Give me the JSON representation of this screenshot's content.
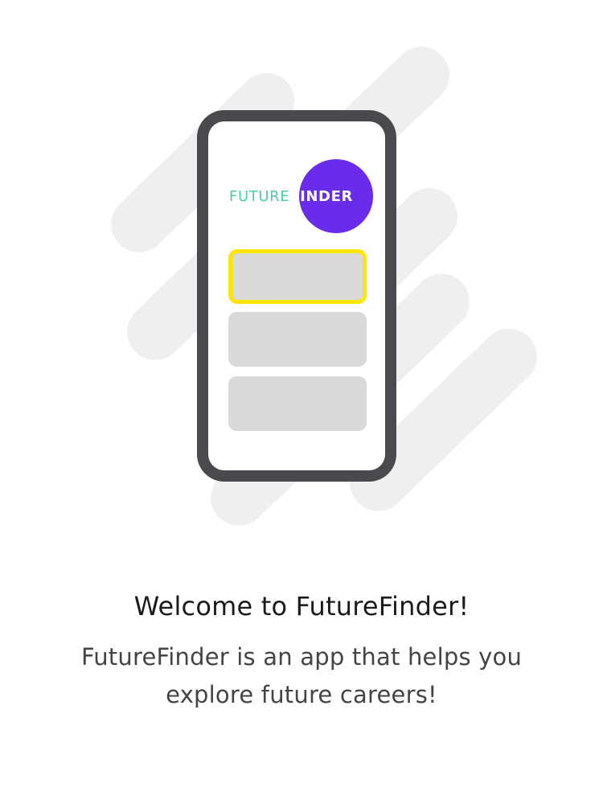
{
  "illustration": {
    "logo": {
      "text_part_1": "FUTURE",
      "text_part_2": "FINDER",
      "color_part_1": "#4ecba8",
      "color_part_2": "#ffffff",
      "circle_color": "#6a2ceb"
    },
    "highlight_color": "#ffe600",
    "card_color": "#d9d9d9",
    "phone_frame_color": "#4a4a4e",
    "stripe_color": "#efefef"
  },
  "welcome": {
    "title": "Welcome to FutureFinder!",
    "subtitle": "FutureFinder is an app that helps you explore future careers!"
  }
}
